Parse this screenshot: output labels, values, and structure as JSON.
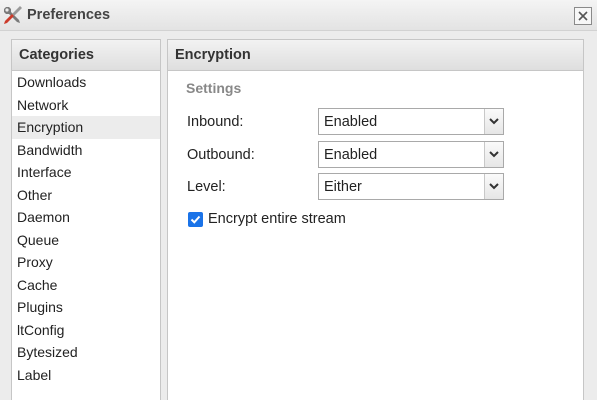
{
  "window": {
    "title": "Preferences",
    "icon": "tools-icon",
    "close_icon": "close-icon"
  },
  "categories": {
    "header": "Categories",
    "selected": "Encryption",
    "items": [
      {
        "label": "Downloads"
      },
      {
        "label": "Network"
      },
      {
        "label": "Encryption"
      },
      {
        "label": "Bandwidth"
      },
      {
        "label": "Interface"
      },
      {
        "label": "Other"
      },
      {
        "label": "Daemon"
      },
      {
        "label": "Queue"
      },
      {
        "label": "Proxy"
      },
      {
        "label": "Cache"
      },
      {
        "label": "Plugins"
      },
      {
        "label": "ltConfig"
      },
      {
        "label": "Bytesized"
      },
      {
        "label": "Label"
      }
    ]
  },
  "encryption": {
    "header": "Encryption",
    "section_title": "Settings",
    "inbound": {
      "label": "Inbound:",
      "value": "Enabled"
    },
    "outbound": {
      "label": "Outbound:",
      "value": "Enabled"
    },
    "level": {
      "label": "Level:",
      "value": "Either"
    },
    "encrypt_stream": {
      "label": "Encrypt entire stream",
      "checked": true
    }
  },
  "colors": {
    "checkbox_accent": "#1a73e8",
    "section_title": "#888888",
    "selected_row": "#ececec"
  }
}
